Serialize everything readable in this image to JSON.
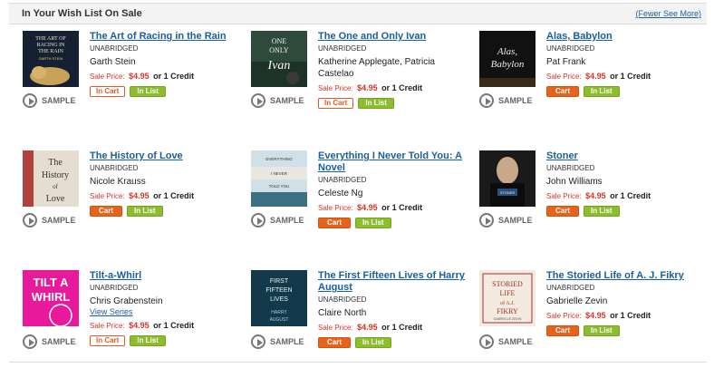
{
  "header": {
    "title": "In Your Wish List On Sale",
    "fewer_link": "(Fewer See More)"
  },
  "sample_label": "SAMPLE",
  "books": [
    {
      "title": "The Art of Racing in the Rain",
      "format": "UNABRIDGED",
      "author": "Garth Stein",
      "series": "",
      "price_label": "Sale Price:",
      "price": "$4.95",
      "credit": "or 1 Credit",
      "cart_label": "In Cart",
      "list_label": "In List",
      "cover_text": "THE ART OF RACING IN THE RAIN",
      "cover_sub": "GARTH STEIN"
    },
    {
      "title": "The One and Only Ivan",
      "format": "UNABRIDGED",
      "author": "Katherine Applegate, Patricia Castelao",
      "series": "",
      "price_label": "Sale Price:",
      "price": "$4.95",
      "credit": "or 1 Credit",
      "cart_label": "In Cart",
      "list_label": "In List",
      "cover_text": "ONE ONLY Ivan",
      "cover_sub": ""
    },
    {
      "title": "Alas, Babylon",
      "format": "UNABRIDGED",
      "author": "Pat Frank",
      "series": "",
      "price_label": "Sale Price:",
      "price": "$4.95",
      "credit": "or 1 Credit",
      "cart_label": "Cart",
      "list_label": "In List",
      "cover_text": "Alas, Babylon",
      "cover_sub": ""
    },
    {
      "title": "The History of Love",
      "format": "UNABRIDGED",
      "author": "Nicole Krauss",
      "series": "",
      "price_label": "Sale Price:",
      "price": "$4.95",
      "credit": "or 1 Credit",
      "cart_label": "Cart",
      "list_label": "In List",
      "cover_text": "The History of Love",
      "cover_sub": ""
    },
    {
      "title": "Everything I Never Told You: A Novel",
      "format": "UNABRIDGED",
      "author": "Celeste Ng",
      "series": "",
      "price_label": "Sale Price:",
      "price": "$4.95",
      "credit": "or 1 Credit",
      "cart_label": "Cart",
      "list_label": "In List",
      "cover_text": "EVERYTHING I NEVER TOLD YOU",
      "cover_sub": ""
    },
    {
      "title": "Stoner",
      "format": "UNABRIDGED",
      "author": "John Williams",
      "series": "",
      "price_label": "Sale Price:",
      "price": "$4.95",
      "credit": "or 1 Credit",
      "cart_label": "Cart",
      "list_label": "In List",
      "cover_text": "STONER",
      "cover_sub": ""
    },
    {
      "title": "Tilt-a-Whirl",
      "format": "UNABRIDGED",
      "author": "Chris Grabenstein",
      "series": "View Series",
      "price_label": "Sale Price:",
      "price": "$4.95",
      "credit": "or 1 Credit",
      "cart_label": "In Cart",
      "list_label": "In List",
      "cover_text": "TILT A WHIRL",
      "cover_sub": ""
    },
    {
      "title": "The First Fifteen Lives of Harry August",
      "format": "UNABRIDGED",
      "author": "Claire North",
      "series": "",
      "price_label": "Sale Price:",
      "price": "$4.95",
      "credit": "or 1 Credit",
      "cart_label": "Cart",
      "list_label": "In List",
      "cover_text": "FIRST FIFTEEN LIVES",
      "cover_sub": "HARRY AUGUST"
    },
    {
      "title": "The Storied Life of A. J. Fikry",
      "format": "UNABRIDGED",
      "author": "Gabrielle Zevin",
      "series": "",
      "price_label": "Sale Price:",
      "price": "$4.95",
      "credit": "or 1 Credit",
      "cart_label": "Cart",
      "list_label": "In List",
      "cover_text": "STORIED LIFE of A.J. FIKRY",
      "cover_sub": "GABRIELLE ZEVIN"
    }
  ]
}
